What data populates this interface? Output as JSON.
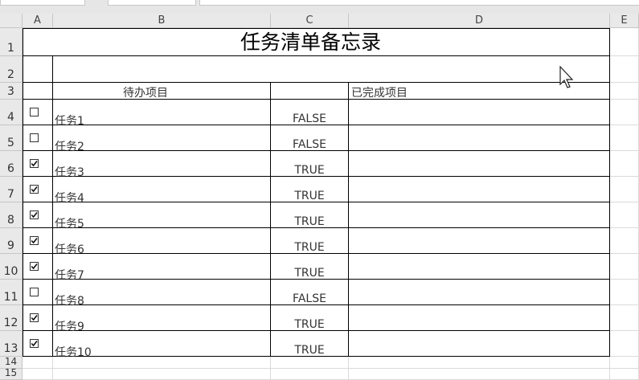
{
  "columns": [
    "A",
    "B",
    "C",
    "D",
    "E"
  ],
  "rows": [
    "1",
    "2",
    "3",
    "4",
    "5",
    "6",
    "7",
    "8",
    "9",
    "10",
    "11",
    "12",
    "13",
    "14",
    "15"
  ],
  "title": "任务清单备忘录",
  "headers": {
    "pending": "待办项目",
    "done": "已完成项目"
  },
  "tasks": [
    {
      "label": "任务1",
      "checked": false,
      "value": "FALSE"
    },
    {
      "label": "任务2",
      "checked": false,
      "value": "FALSE"
    },
    {
      "label": "任务3",
      "checked": true,
      "value": "TRUE"
    },
    {
      "label": "任务4",
      "checked": true,
      "value": "TRUE"
    },
    {
      "label": "任务5",
      "checked": true,
      "value": "TRUE"
    },
    {
      "label": "任务6",
      "checked": true,
      "value": "TRUE"
    },
    {
      "label": "任务7",
      "checked": true,
      "value": "TRUE"
    },
    {
      "label": "任务8",
      "checked": false,
      "value": "FALSE"
    },
    {
      "label": "任务9",
      "checked": true,
      "value": "TRUE"
    },
    {
      "label": "任务10",
      "checked": true,
      "value": "TRUE"
    }
  ]
}
